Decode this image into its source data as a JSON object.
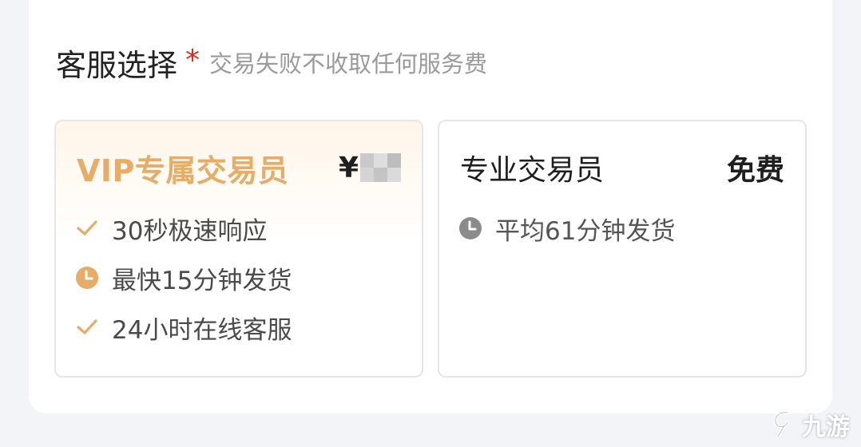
{
  "section": {
    "title": "客服选择",
    "required_mark": "*",
    "hint": "交易失败不收取任何服务费"
  },
  "vip_card": {
    "title": "VIP专属交易员",
    "price_symbol": "¥",
    "features": [
      {
        "icon": "check-icon",
        "text": "30秒极速响应"
      },
      {
        "icon": "clock-icon",
        "text": "最快15分钟发货"
      },
      {
        "icon": "check-icon",
        "text": "24小时在线客服"
      }
    ]
  },
  "pro_card": {
    "title": "专业交易员",
    "price": "免费",
    "features": [
      {
        "icon": "clock-icon",
        "text": "平均61分钟发货"
      }
    ]
  },
  "watermark": {
    "text": "九游",
    "icon": "jiuyou-logo"
  },
  "colors": {
    "vip_gold": "#e5ad68",
    "required_red": "#e0281d",
    "hint_gray": "#9a9a9a",
    "clock_gray": "#8b8b8b",
    "card_border": "#e6e6e6"
  }
}
